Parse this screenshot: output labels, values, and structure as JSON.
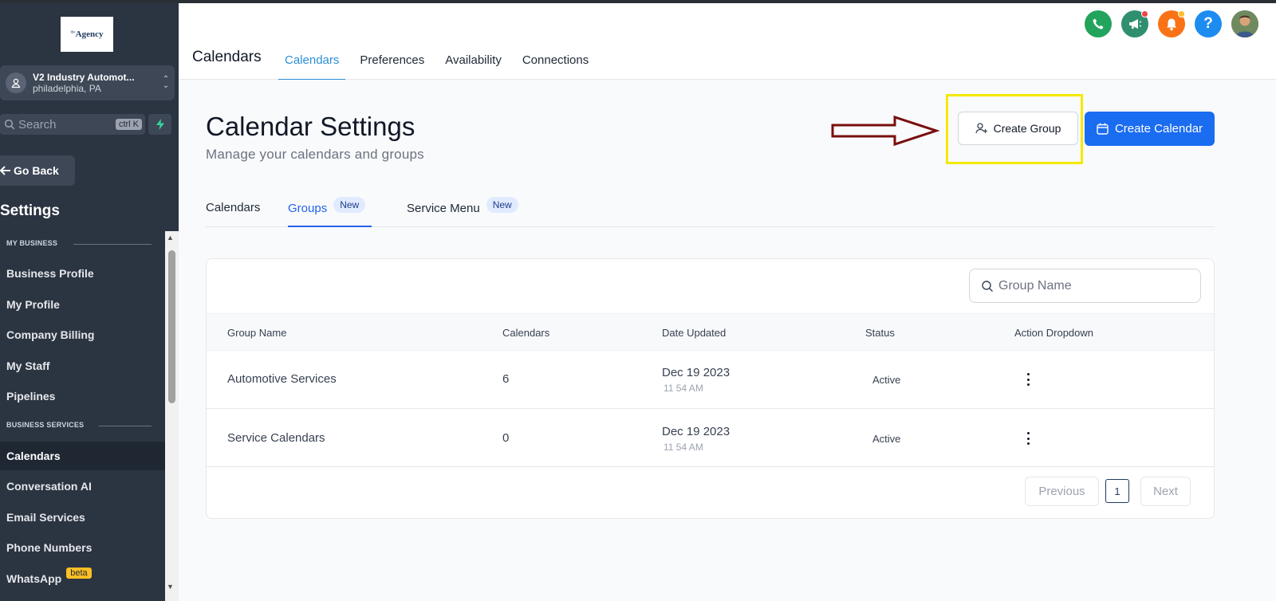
{
  "sidebar": {
    "logo_text": "Agency",
    "logo_sup": "the",
    "location": {
      "name": "V2 Industry Automot...",
      "city": "philadelphia, PA"
    },
    "search": {
      "placeholder": "Search",
      "shortcut": "ctrl K"
    },
    "go_back": "Go Back",
    "title": "Settings",
    "sections": [
      {
        "label": "MY BUSINESS",
        "items": [
          "Business Profile",
          "My Profile",
          "Company Billing",
          "My Staff",
          "Pipelines"
        ]
      },
      {
        "label": "BUSINESS SERVICES",
        "items": [
          "Calendars",
          "Conversation AI",
          "Email Services",
          "Phone Numbers",
          "WhatsApp"
        ]
      }
    ],
    "active_item": "Calendars",
    "whatsapp_badge": "beta"
  },
  "header": {
    "icons": [
      "phone-icon",
      "megaphone-icon",
      "bell-icon",
      "help-icon",
      "avatar"
    ],
    "colors": {
      "phone": "#22a45d",
      "megaphone": "#2f8f6f",
      "bell": "#f97316",
      "help": "#1d8cf0"
    }
  },
  "topnav": {
    "title": "Calendars",
    "tabs": [
      "Calendars",
      "Preferences",
      "Availability",
      "Connections"
    ],
    "active_tab": "Calendars"
  },
  "main": {
    "title": "Calendar Settings",
    "subtitle": "Manage your calendars and groups",
    "create_group_label": "Create Group",
    "create_calendar_label": "Create Calendar",
    "accent_color": "#1a6cf0",
    "highlight_color": "#f5e900",
    "arrow_color": "#7a0e0e",
    "subtabs": [
      {
        "label": "Calendars",
        "badge": ""
      },
      {
        "label": "Groups",
        "badge": "New"
      },
      {
        "label": "Service Menu",
        "badge": "New"
      }
    ],
    "active_subtab": "Groups"
  },
  "table": {
    "search_placeholder": "Group Name",
    "columns": [
      "Group Name",
      "Calendars",
      "Date Updated",
      "Status",
      "Action Dropdown"
    ],
    "rows": [
      {
        "name": "Automotive Services",
        "calendars": "6",
        "date": "Dec 19 2023",
        "time": "11 54 AM",
        "status": "Active"
      },
      {
        "name": "Service Calendars",
        "calendars": "0",
        "date": "Dec 19 2023",
        "time": "11 54 AM",
        "status": "Active"
      }
    ],
    "pagination": {
      "previous": "Previous",
      "page": "1",
      "next": "Next"
    }
  }
}
